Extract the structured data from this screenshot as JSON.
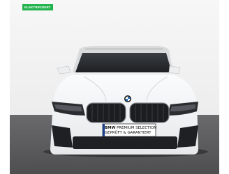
{
  "badge": {
    "label": "ELEKTRIFIZIERT",
    "color": "#22b24c"
  },
  "plate": {
    "brand": "BMW",
    "line1_rest": "PREMIUM SELECTION",
    "line2": "GEPRÜFT & GARANTIERT"
  },
  "scene": {
    "background": "#f4f4f4",
    "floor": "#5c5c5e",
    "car_color": "#f3f4f6"
  }
}
